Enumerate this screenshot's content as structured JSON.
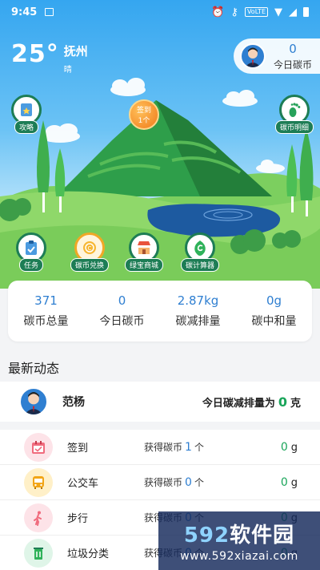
{
  "status_bar": {
    "time": "9:45",
    "network": "VoLTE"
  },
  "weather": {
    "temperature": "25°",
    "city": "抚州",
    "condition": "晴"
  },
  "coin_pill": {
    "value": "0",
    "label": "今日碳币"
  },
  "hero_buttons": {
    "guide": "攻略",
    "coin_detail": "碳币明细",
    "sign_in": {
      "title": "签到",
      "count": "1个"
    },
    "task": "任务",
    "coin_exchange": "碳币兑换",
    "green_mall": "绿宝商城",
    "carbon_calculator": "碳计算器"
  },
  "stats": [
    {
      "value": "371",
      "label": "碳币总量"
    },
    {
      "value": "0",
      "label": "今日碳币"
    },
    {
      "value": "2.87kg",
      "label": "碳减排量"
    },
    {
      "value": "0g",
      "label": "碳中和量"
    }
  ],
  "feed": {
    "title": "最新动态",
    "user": {
      "name": "范杨",
      "summary_prefix": "今日碳减排量为",
      "summary_value": "0",
      "summary_unit": "克"
    }
  },
  "activities": [
    {
      "icon": "calendar-icon",
      "name": "签到",
      "earn_prefix": "获得碳币",
      "earn_value": "1",
      "earn_unit": "个",
      "amount": "0",
      "unit": "g",
      "color": "#fde3e8"
    },
    {
      "icon": "bus-icon",
      "name": "公交车",
      "earn_prefix": "获得碳币",
      "earn_value": "0",
      "earn_unit": "个",
      "amount": "0",
      "unit": "g",
      "color": "#fff0c8"
    },
    {
      "icon": "walking-icon",
      "name": "步行",
      "earn_prefix": "获得碳币",
      "earn_value": "0",
      "earn_unit": "个",
      "amount": "0",
      "unit": "g",
      "color": "#fde3e8"
    },
    {
      "icon": "recycle-icon",
      "name": "垃圾分类",
      "earn_prefix": "获得碳币",
      "earn_value": "0",
      "earn_unit": "个",
      "amount": "0",
      "unit": "g",
      "color": "#dff5e8"
    }
  ],
  "watermark": {
    "logo_num": "592",
    "logo_text": "软件园",
    "url": "www.592xiazai.com"
  },
  "colors": {
    "accent": "#2f7fd1",
    "green": "#1aa55a",
    "dark_green": "#1d7d55",
    "sky": "#35a6f0"
  }
}
